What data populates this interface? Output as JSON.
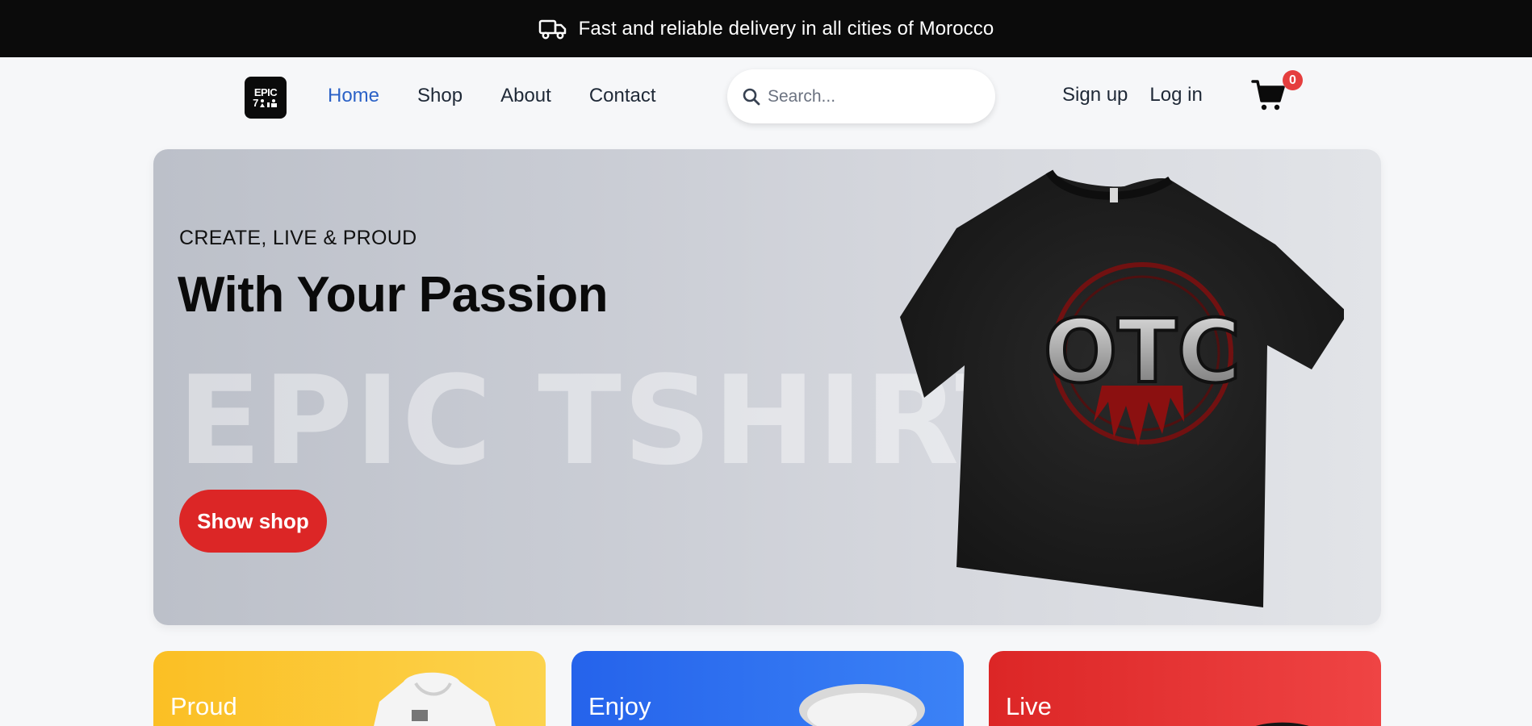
{
  "announcement": {
    "text": "Fast and reliable delivery in all cities of Morocco",
    "icon": "truck-icon"
  },
  "header": {
    "logo_line1": "EPIC",
    "logo_line2": "7",
    "nav": [
      {
        "label": "Home",
        "active": true
      },
      {
        "label": "Shop",
        "active": false
      },
      {
        "label": "About",
        "active": false
      },
      {
        "label": "Contact",
        "active": false
      }
    ],
    "search": {
      "placeholder": "Search...",
      "value": "",
      "icon": "search-icon"
    },
    "auth": {
      "signup": "Sign up",
      "login": "Log in"
    },
    "cart": {
      "icon": "cart-icon",
      "count": "0"
    },
    "active_color": "#2c62c7"
  },
  "hero": {
    "kicker": "CREATE, LIVE & PROUD",
    "title": "With Your Passion",
    "watermark": "EPIC TSHIRT",
    "button": "Show shop",
    "button_color": "#dc2626",
    "shirt_print": "OTC"
  },
  "categories": [
    {
      "label": "Proud",
      "color": "#fbbf24"
    },
    {
      "label": "Enjoy",
      "color": "#2563eb"
    },
    {
      "label": "Live",
      "color": "#dc2626"
    }
  ]
}
